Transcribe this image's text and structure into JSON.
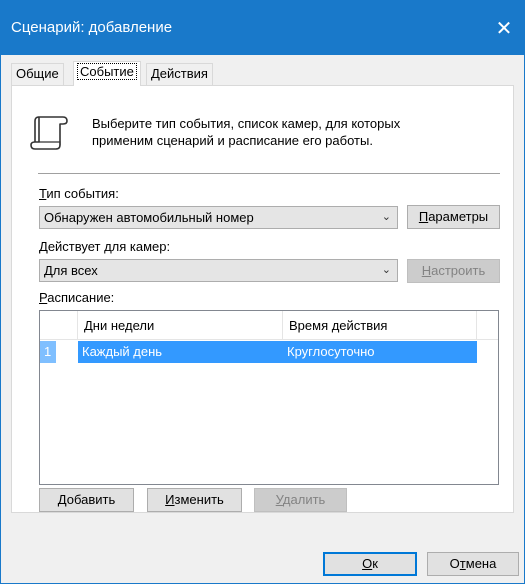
{
  "window": {
    "title": "Сценарий: добавление",
    "close_glyph": "✕",
    "accent_color": "#1979ca"
  },
  "tabs": [
    {
      "label": "Общие",
      "active": false
    },
    {
      "label": "Событие",
      "active": true
    },
    {
      "label": "Действия",
      "active": false
    }
  ],
  "description": {
    "line1": "Выберите тип события, список камер, для которых",
    "line2": "применим сценарий и расписание его работы.",
    "icon": "scroll-icon"
  },
  "event_type": {
    "label_hotkey": "Т",
    "label_rest": "ип события:",
    "value": "Обнаружен автомобильный номер",
    "params_hotkey": "П",
    "params_rest": "араметры"
  },
  "cameras": {
    "label_hotkey": "Д",
    "label_rest": "ействует для камер:",
    "value": "Для всех",
    "configure_hotkey": "Н",
    "configure_rest": "астроить"
  },
  "schedule": {
    "label_hotkey": "Р",
    "label_rest": "асписание:",
    "columns": [
      "Дни недели",
      "Время действия"
    ],
    "rows": [
      {
        "index": "1",
        "days": "Каждый день",
        "time": "Круглосуточно"
      }
    ],
    "selection_color": "#3399ff"
  },
  "schedule_buttons": {
    "add_hotkey": "Д",
    "add_rest": "обавить",
    "edit_hotkey": "И",
    "edit_rest": "зменить",
    "delete_hotkey": "У",
    "delete_rest": "далить"
  },
  "footer": {
    "ok_hotkey": "О",
    "ok_rest": "к",
    "cancel_pre": "О",
    "cancel_hotkey": "т",
    "cancel_rest": "мена"
  }
}
